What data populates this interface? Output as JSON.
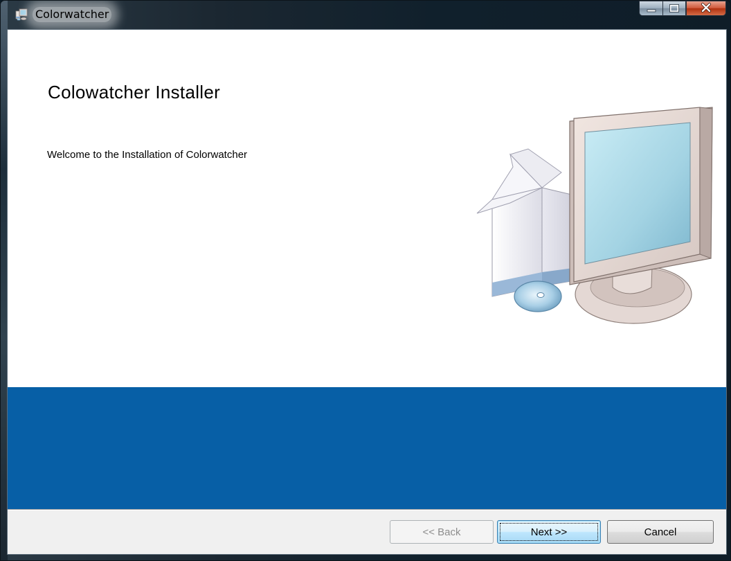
{
  "window": {
    "title": "Colorwatcher",
    "app_icon": "installer-computer-icon",
    "caption_buttons": [
      "minimize-icon",
      "maximize-icon",
      "close-icon"
    ]
  },
  "welcome": {
    "heading": "Colowatcher Installer",
    "message": "Welcome to the Installation of Colorwatcher",
    "illustration": "computer-with-box-and-cd"
  },
  "buttons": {
    "back_label": "<< Back",
    "back_enabled": false,
    "next_label": "Next >>",
    "cancel_label": "Cancel"
  },
  "colors": {
    "band": "#075fa6",
    "background": "#ffffff",
    "button_bar": "#f0f0f0"
  }
}
